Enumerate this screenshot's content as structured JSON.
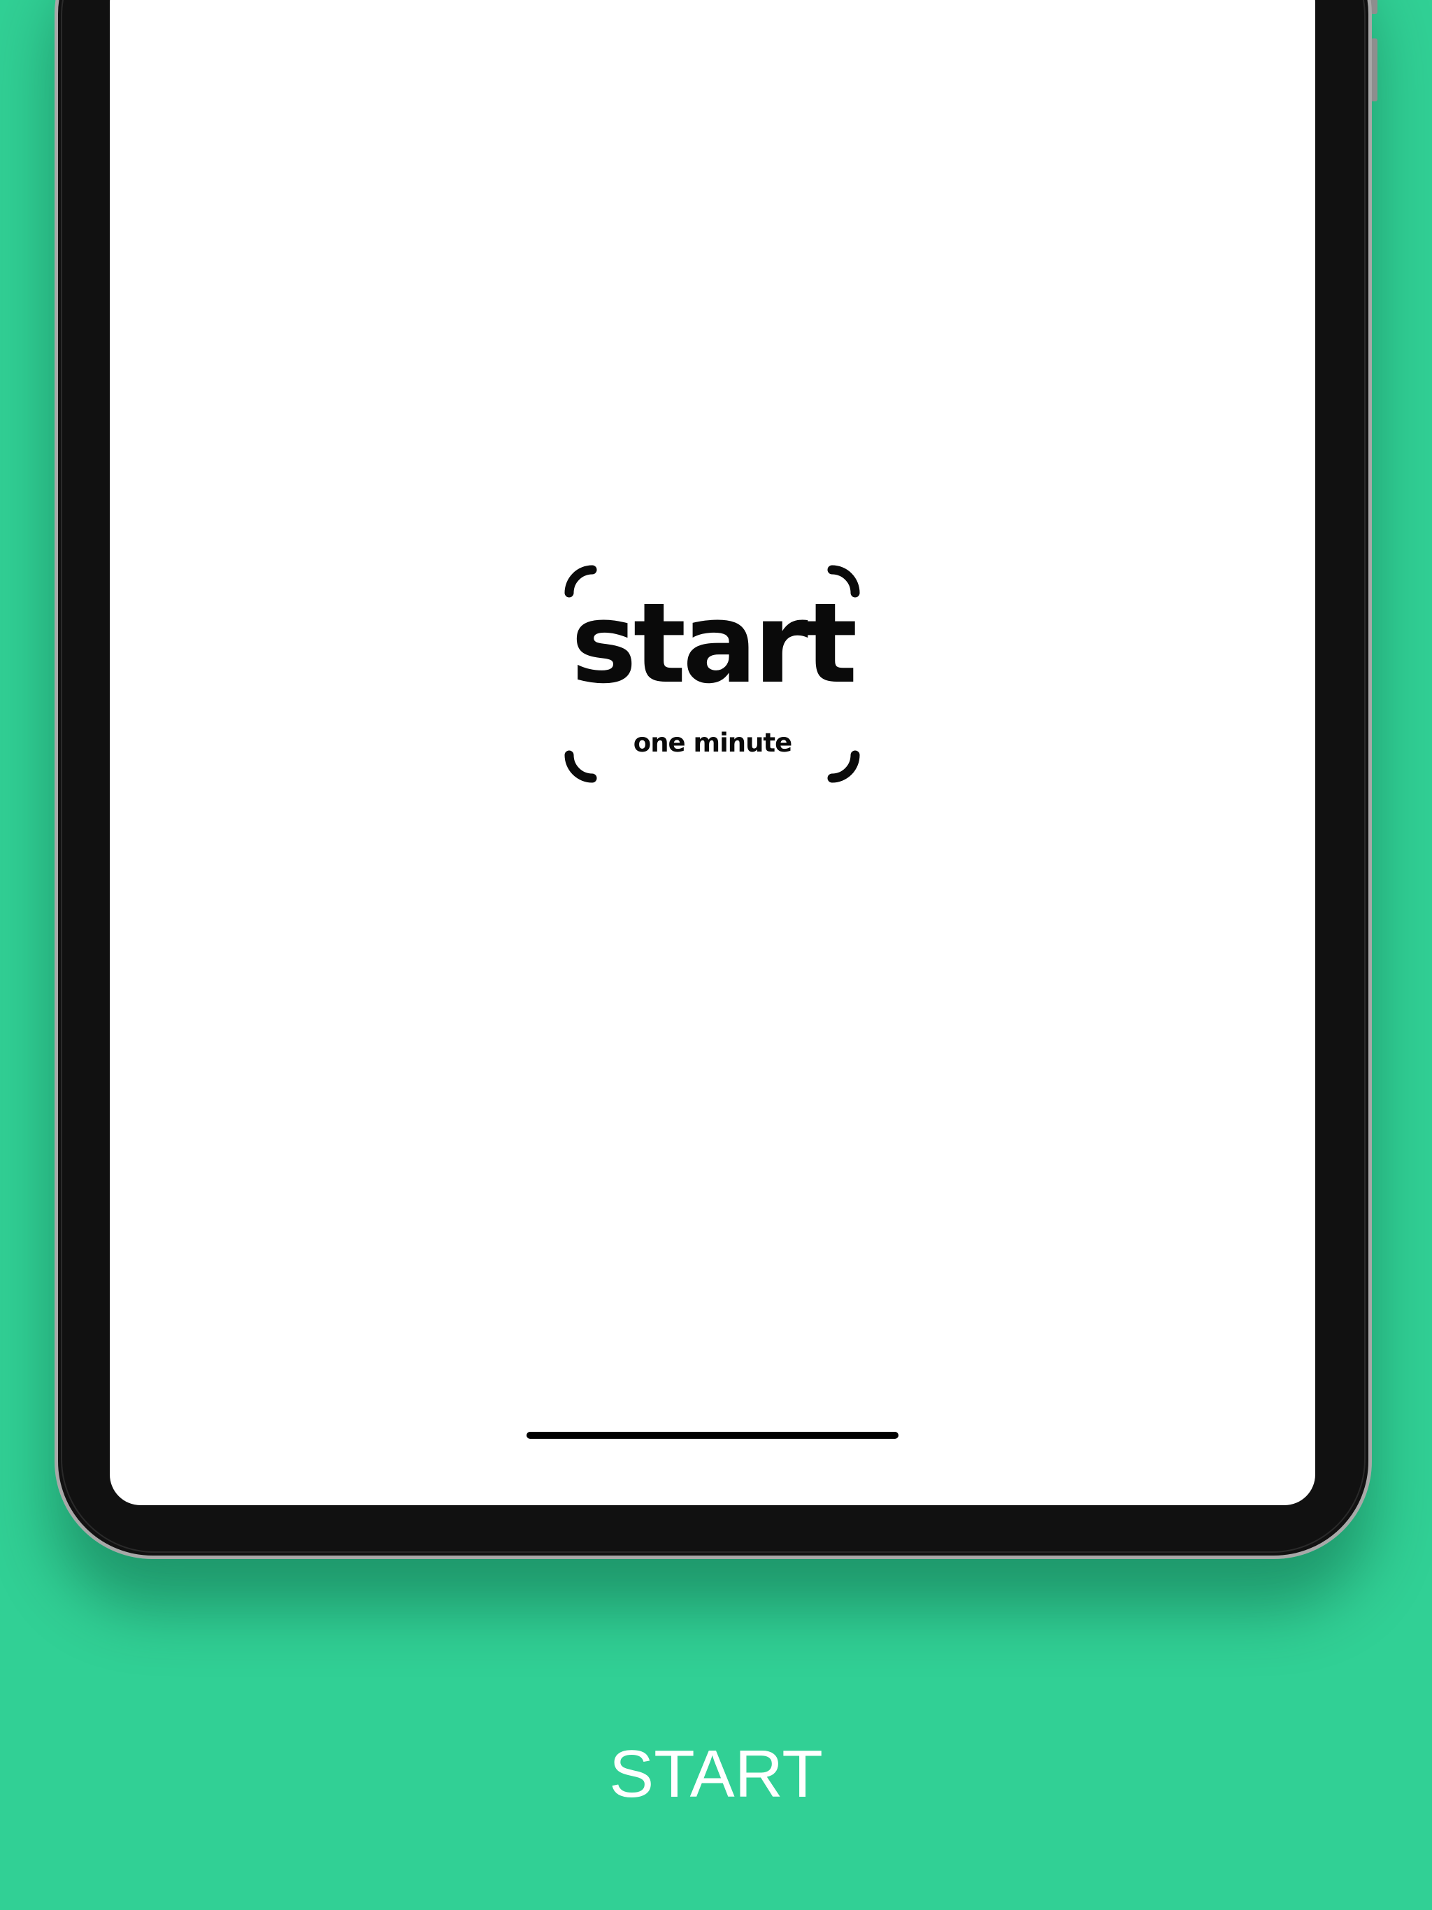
{
  "background_color": "#31d095",
  "app": {
    "logo_word": "start",
    "logo_tagline": "one minute"
  },
  "caption": {
    "text": "START"
  }
}
